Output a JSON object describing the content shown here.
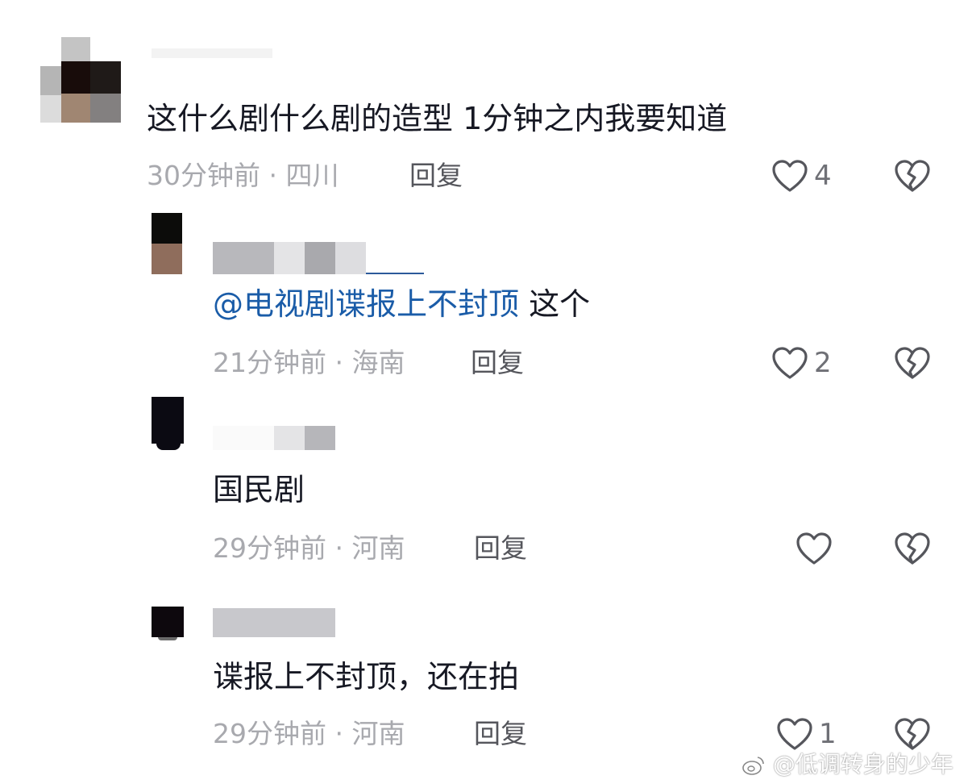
{
  "colors": {
    "text": "#161823",
    "meta": "#a8a9ae",
    "reply": "#55565c",
    "mention": "#1a5ca8",
    "icon": "#55565c"
  },
  "comments": [
    {
      "text": "这什么剧什么剧的造型 1分钟之内我要知道",
      "time": "30分钟前",
      "location": "四川",
      "reply_label": "回复",
      "likes": "4",
      "like_icon": "heart-outline-icon",
      "dislike_icon": "broken-heart-icon"
    },
    {
      "mention": "@电视剧谍报上不封顶",
      "text": " 这个",
      "time": "21分钟前",
      "location": "海南",
      "reply_label": "回复",
      "likes": "2",
      "like_icon": "heart-outline-icon",
      "dislike_icon": "broken-heart-icon"
    },
    {
      "text": "国民剧",
      "time": "29分钟前",
      "location": "河南",
      "reply_label": "回复",
      "likes": "",
      "like_icon": "heart-outline-icon",
      "dislike_icon": "broken-heart-icon"
    },
    {
      "text": "谍报上不封顶，还在拍",
      "time": "29分钟前",
      "location": "河南",
      "reply_label": "回复",
      "likes": "1",
      "like_icon": "heart-outline-icon",
      "dislike_icon": "broken-heart-icon"
    }
  ],
  "separator": "·",
  "watermark": "@低调转身的少年"
}
